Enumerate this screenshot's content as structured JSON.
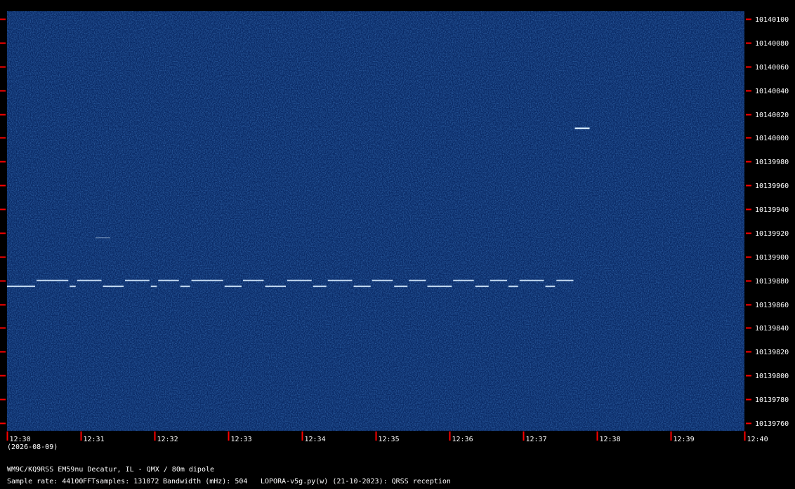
{
  "chart_data": {
    "type": "heatmap",
    "title": "",
    "xlabel": "",
    "ylabel": "",
    "x_ticks": [
      "12:30",
      "12:31",
      "12:32",
      "12:33",
      "12:34",
      "12:35",
      "12:36",
      "12:37",
      "12:38",
      "12:39",
      "12:40"
    ],
    "y_ticks": [
      "10140100",
      "10140080",
      "10140060",
      "10140040",
      "10140020",
      "10140000",
      "10139980",
      "10139960",
      "10139940",
      "10139920",
      "10139900",
      "10139880",
      "10139860",
      "10139840",
      "10139820",
      "10139800",
      "10139780",
      "10139760"
    ],
    "ylim": [
      10139760,
      10140100
    ],
    "colors": {
      "background": "#0a2a66",
      "signal": "#d8ecff",
      "tick_red": "#ff0000"
    },
    "signals": [
      {
        "label": "",
        "freq_hz": 10139875,
        "freq_alt_hz": 10139880,
        "start": "12:30",
        "end": "12:37.7",
        "kind": "FSK-CW trace"
      },
      {
        "label": "",
        "freq_hz": 10140008,
        "start": "12:37.7",
        "end": "12:37.9",
        "kind": "short carrier"
      },
      {
        "label": "",
        "freq_hz": 10139916,
        "start": "12:31.2",
        "end": "12:31.4",
        "kind": "faint trace"
      }
    ]
  },
  "footer": {
    "date": "(2026-08-09)",
    "station": "WM9C/KQ9RSS EM59nu Decatur, IL - QMX / 80m dipole",
    "sample_rate": "Sample rate: 44100",
    "fft_samples": "FFTsamples: 131072",
    "bandwidth": "Bandwidth (mHz): 504",
    "software": "LOPORA-v5g.py(w) (21-10-2023): QRSS reception"
  }
}
